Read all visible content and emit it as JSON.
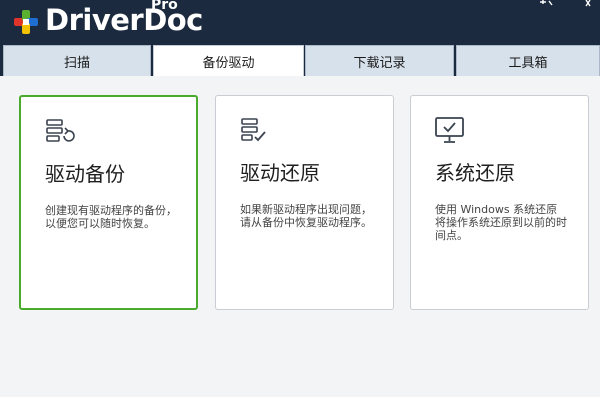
{
  "app": {
    "brand_name": "DriverDoc",
    "edition": "Pro",
    "logo_icon": "plus-cross-logo-icon"
  },
  "window_controls": [
    "help-icon",
    "close-icon"
  ],
  "tabs": [
    {
      "label": "扫描",
      "active": false
    },
    {
      "label": "备份驱动",
      "active": true
    },
    {
      "label": "下载记录",
      "active": false
    },
    {
      "label": "工具箱",
      "active": false
    }
  ],
  "cards": [
    {
      "title": "驱动备份",
      "description": "创建现有驱动程序的备份，以便您可以随时恢复。",
      "icon": "backup-restore-icon",
      "selected": true
    },
    {
      "title": "驱动还原",
      "description": "如果新驱动程序出现问题，请从备份中恢复驱动程序。",
      "icon": "checklist-icon",
      "selected": false
    },
    {
      "title": "系统还原",
      "description": "使用 Windows 系统还原将操作系统还原到以前的时间点。",
      "icon": "monitor-check-icon",
      "selected": false
    }
  ],
  "colors": {
    "titlebar_bg": "#1b2a3e",
    "tab_bg": "#d7e1ec",
    "content_bg": "#f2f4f6",
    "selected_border": "#4aaa2d",
    "logo_red": "#e0342b",
    "logo_green": "#5bb031",
    "logo_blue": "#1e6fd1",
    "logo_yellow": "#f2c200"
  }
}
